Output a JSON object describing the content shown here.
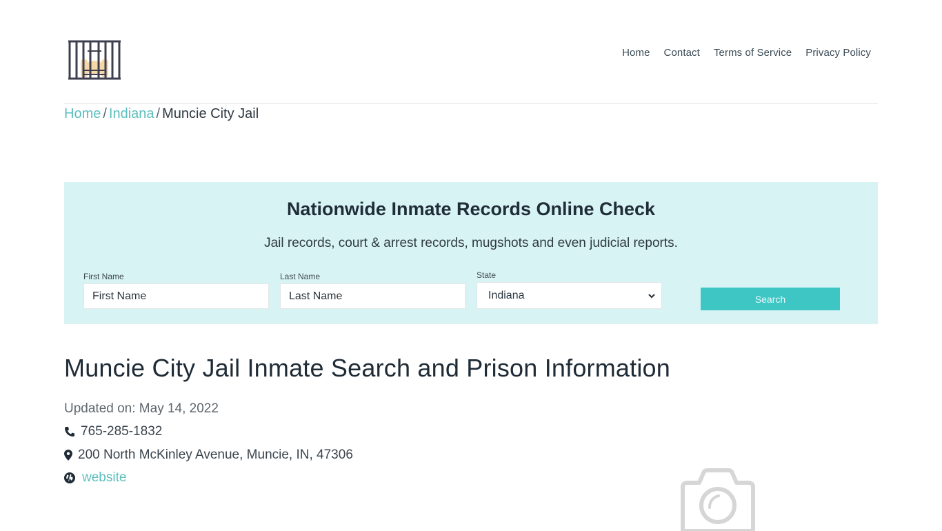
{
  "header": {
    "logo_icon": "jail-bars-logo-icon",
    "nav": [
      {
        "label": "Home"
      },
      {
        "label": "Contact"
      },
      {
        "label": "Terms of Service"
      },
      {
        "label": "Privacy Policy"
      }
    ]
  },
  "breadcrumb": {
    "items": [
      {
        "label": "Home",
        "link": true
      },
      {
        "label": "Indiana",
        "link": true
      },
      {
        "label": "Muncie City Jail",
        "link": false
      }
    ],
    "separator": "/"
  },
  "search_panel": {
    "title": "Nationwide Inmate Records Online Check",
    "subtitle": "Jail records, court & arrest records, mugshots and even judicial reports.",
    "first_name": {
      "label": "First Name",
      "placeholder": "First Name",
      "value": ""
    },
    "last_name": {
      "label": "Last Name",
      "placeholder": "Last Name",
      "value": ""
    },
    "state": {
      "label": "State",
      "selected": "Indiana"
    },
    "search_label": "Search",
    "colors": {
      "panel_bg": "#d8f3f4",
      "button_bg": "#3ec6c4"
    }
  },
  "main": {
    "title": "Muncie City Jail Inmate Search and Prison Information",
    "updated": "Updated on: May 14, 2022",
    "phone": "765-285-1832",
    "address": "200 North McKinley Avenue, Muncie, IN, 47306",
    "website_label": "website",
    "image_placeholder_icon": "camera-icon"
  },
  "colors": {
    "accent": "#5bbfbd",
    "text": "#1f2b36"
  }
}
